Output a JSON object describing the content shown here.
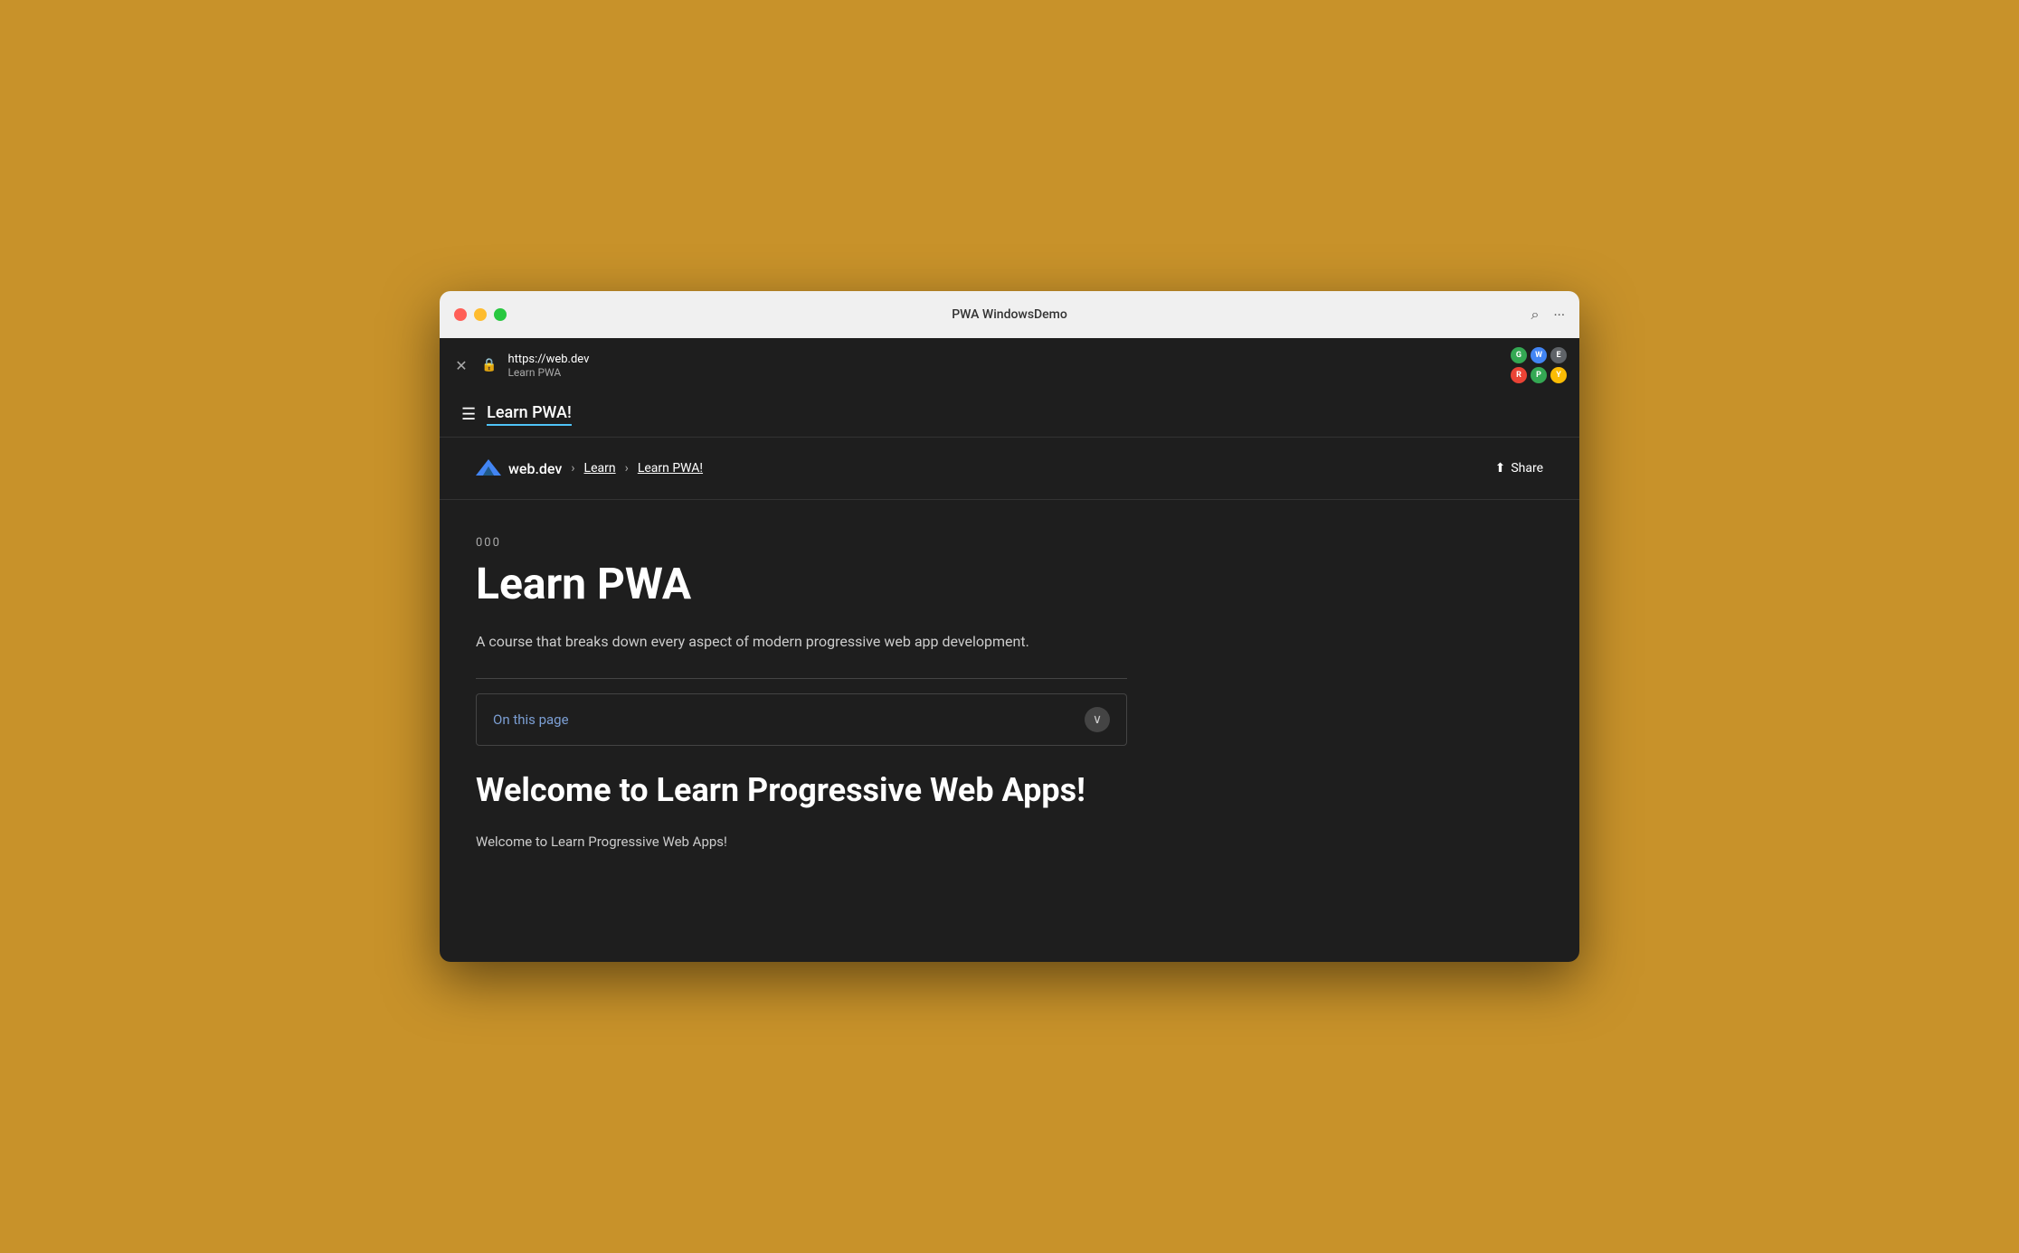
{
  "window": {
    "title": "PWA WindowsDemo",
    "background_color": "#C8922A"
  },
  "title_bar": {
    "traffic_lights": [
      {
        "name": "close",
        "color": "#FF5F57"
      },
      {
        "name": "minimize",
        "color": "#FEBC2E"
      },
      {
        "name": "maximize",
        "color": "#28C840"
      }
    ],
    "title": "PWA WindowsDemo",
    "search_icon": "⌕",
    "more_icon": "···"
  },
  "browser_chrome": {
    "close_label": "✕",
    "lock_icon": "🔒",
    "url": "https://web.dev",
    "page_title": "Learn PWA",
    "extension_icons": [
      {
        "color": "#34a853",
        "label": "G"
      },
      {
        "color": "#4285f4",
        "label": "W"
      },
      {
        "color": "#5f6368",
        "label": "E"
      },
      {
        "color": "#ea4335",
        "label": "R"
      },
      {
        "color": "#34a853",
        "label": "P"
      },
      {
        "color": "#fbbc04",
        "label": "Y"
      }
    ]
  },
  "navbar": {
    "hamburger_icon": "☰",
    "title": "Learn PWA!"
  },
  "breadcrumb": {
    "logo_text": "web.dev",
    "items": [
      {
        "label": "Learn",
        "href": "#"
      },
      {
        "label": "Learn PWA!",
        "href": "#"
      }
    ],
    "separator": "›"
  },
  "share_button": {
    "icon": "⬆",
    "label": "Share"
  },
  "content": {
    "course_number": "000",
    "course_title": "Learn PWA",
    "course_desc": "A course that breaks down every aspect of modern progressive web app development.",
    "on_this_page_label": "On this page",
    "chevron_icon": "∨",
    "welcome_heading": "Welcome to Learn Progressive Web Apps!",
    "welcome_text": "Welcome to Learn Progressive Web Apps!"
  }
}
